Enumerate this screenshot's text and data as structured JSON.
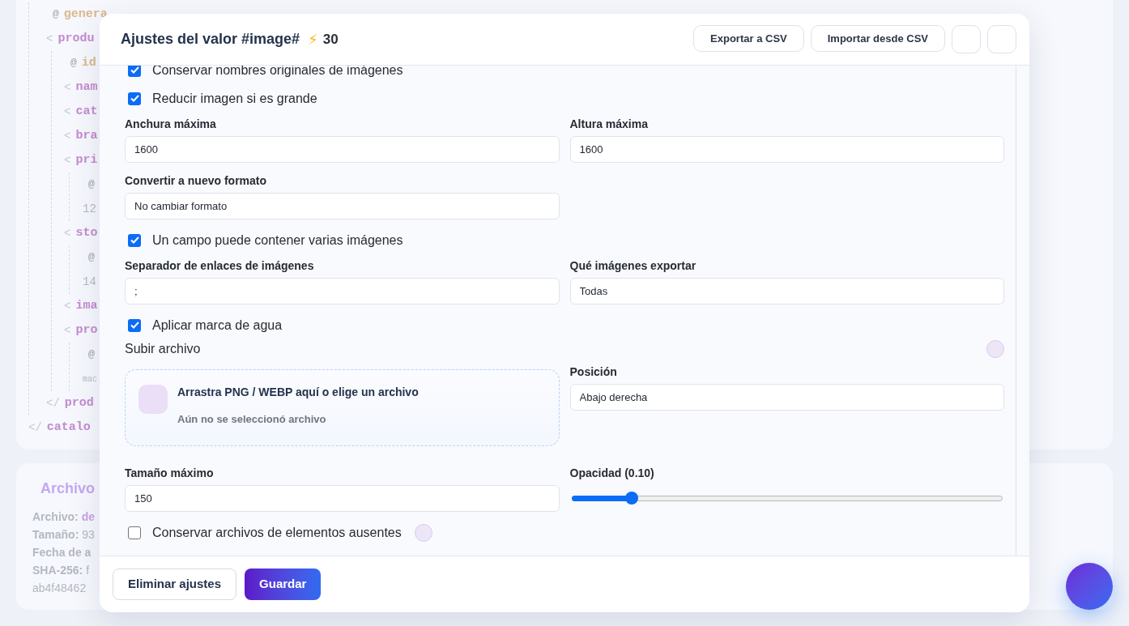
{
  "code": {
    "children": [
      {
        "kind": "attr",
        "mark": "@",
        "text": "genera"
      },
      {
        "kind": "tag",
        "mark": "<",
        "text": "produ",
        "children": [
          {
            "kind": "attr",
            "mark": "@",
            "text": "id"
          },
          {
            "kind": "tag",
            "mark": "<",
            "text": "nam"
          },
          {
            "kind": "tag",
            "mark": "<",
            "text": "cat"
          },
          {
            "kind": "tag",
            "mark": "<",
            "text": "bra"
          },
          {
            "kind": "tag",
            "mark": "<",
            "text": "pri",
            "children": [
              {
                "kind": "attr",
                "mark": "@"
              },
              {
                "kind": "value",
                "text": "12"
              }
            ]
          },
          {
            "kind": "tag",
            "mark": "<",
            "text": "sto",
            "children": [
              {
                "kind": "attr",
                "mark": "@"
              },
              {
                "kind": "value",
                "text": "14"
              }
            ]
          },
          {
            "kind": "tag",
            "mark": "<",
            "text": "ima"
          },
          {
            "kind": "tag",
            "mark": "<",
            "text": "pro",
            "children": [
              {
                "kind": "attr",
                "mark": "@"
              },
              {
                "kind": "small",
                "text": "mac"
              }
            ]
          }
        ]
      },
      {
        "kind": "tag",
        "mark": "</",
        "text": "prod"
      }
    ],
    "close_mark": "</",
    "close_name": "catalo"
  },
  "file_card": {
    "title": "Archivo",
    "lines": [
      {
        "label": "Archivo:",
        "value": "de",
        "kind": "link"
      },
      {
        "label": "Tamaño:",
        "value": "93",
        "kind": "plain"
      },
      {
        "label": "Fecha de a"
      },
      {
        "label": "SHA-256:",
        "value": "f",
        "kind": "plain"
      },
      {
        "value": "ab4f48462",
        "kind": "plain"
      }
    ]
  },
  "modal": {
    "title": "Ajustes del valor #image#",
    "badge_icon": "⚡",
    "badge_count": "30",
    "header_buttons": [
      {
        "kind": "text",
        "label": "Exportar a CSV"
      },
      {
        "kind": "text",
        "label": "Importar desde CSV"
      },
      {
        "kind": "empty"
      },
      {
        "kind": "empty"
      }
    ],
    "settings": [
      {
        "kind": "checkbox",
        "label": "Conservar nombres originales de imágenes",
        "checked": true
      },
      {
        "kind": "checkbox",
        "label": "Reducir imagen si es grande",
        "checked": true
      },
      {
        "kind": "fields",
        "fields": [
          {
            "kind": "input",
            "label": "Anchura máxima",
            "value": "1600"
          },
          {
            "kind": "input",
            "label": "Altura máxima",
            "value": "1600"
          }
        ]
      },
      {
        "kind": "fields",
        "fields": [
          {
            "kind": "input",
            "label": "Convertir a nuevo formato",
            "value": "No cambiar formato"
          }
        ]
      },
      {
        "kind": "checkbox",
        "label": "Un campo puede contener varias imágenes",
        "checked": true
      },
      {
        "kind": "fields",
        "fields": [
          {
            "kind": "input",
            "label": "Separador de enlaces de imágenes",
            "value": ";"
          },
          {
            "kind": "input",
            "label": "Qué imágenes exportar",
            "value": "Todas"
          }
        ]
      },
      {
        "kind": "checkbox",
        "label": "Aplicar marca de agua",
        "checked": true
      },
      {
        "kind": "watermark",
        "heading": "Subir archivo",
        "drop_title": "Arrastra PNG / WEBP aquí o elige un archivo",
        "drop_hint": "Aún no se seleccionó archivo",
        "position": {
          "label": "Posición",
          "value": "Abajo derecha"
        }
      },
      {
        "kind": "fields",
        "fields": [
          {
            "kind": "input",
            "label": "Tamaño máximo",
            "value": "150"
          },
          {
            "kind": "slider",
            "label": "Opacidad (0.10)",
            "level": 0.14
          }
        ]
      },
      {
        "kind": "checkbox",
        "label": "Conservar archivos de elementos ausentes",
        "checked": false,
        "info": true
      }
    ],
    "footer_buttons": [
      {
        "kind": "secondary",
        "label": "Eliminar ajustes"
      },
      {
        "kind": "primary",
        "label": "Guardar"
      }
    ]
  }
}
